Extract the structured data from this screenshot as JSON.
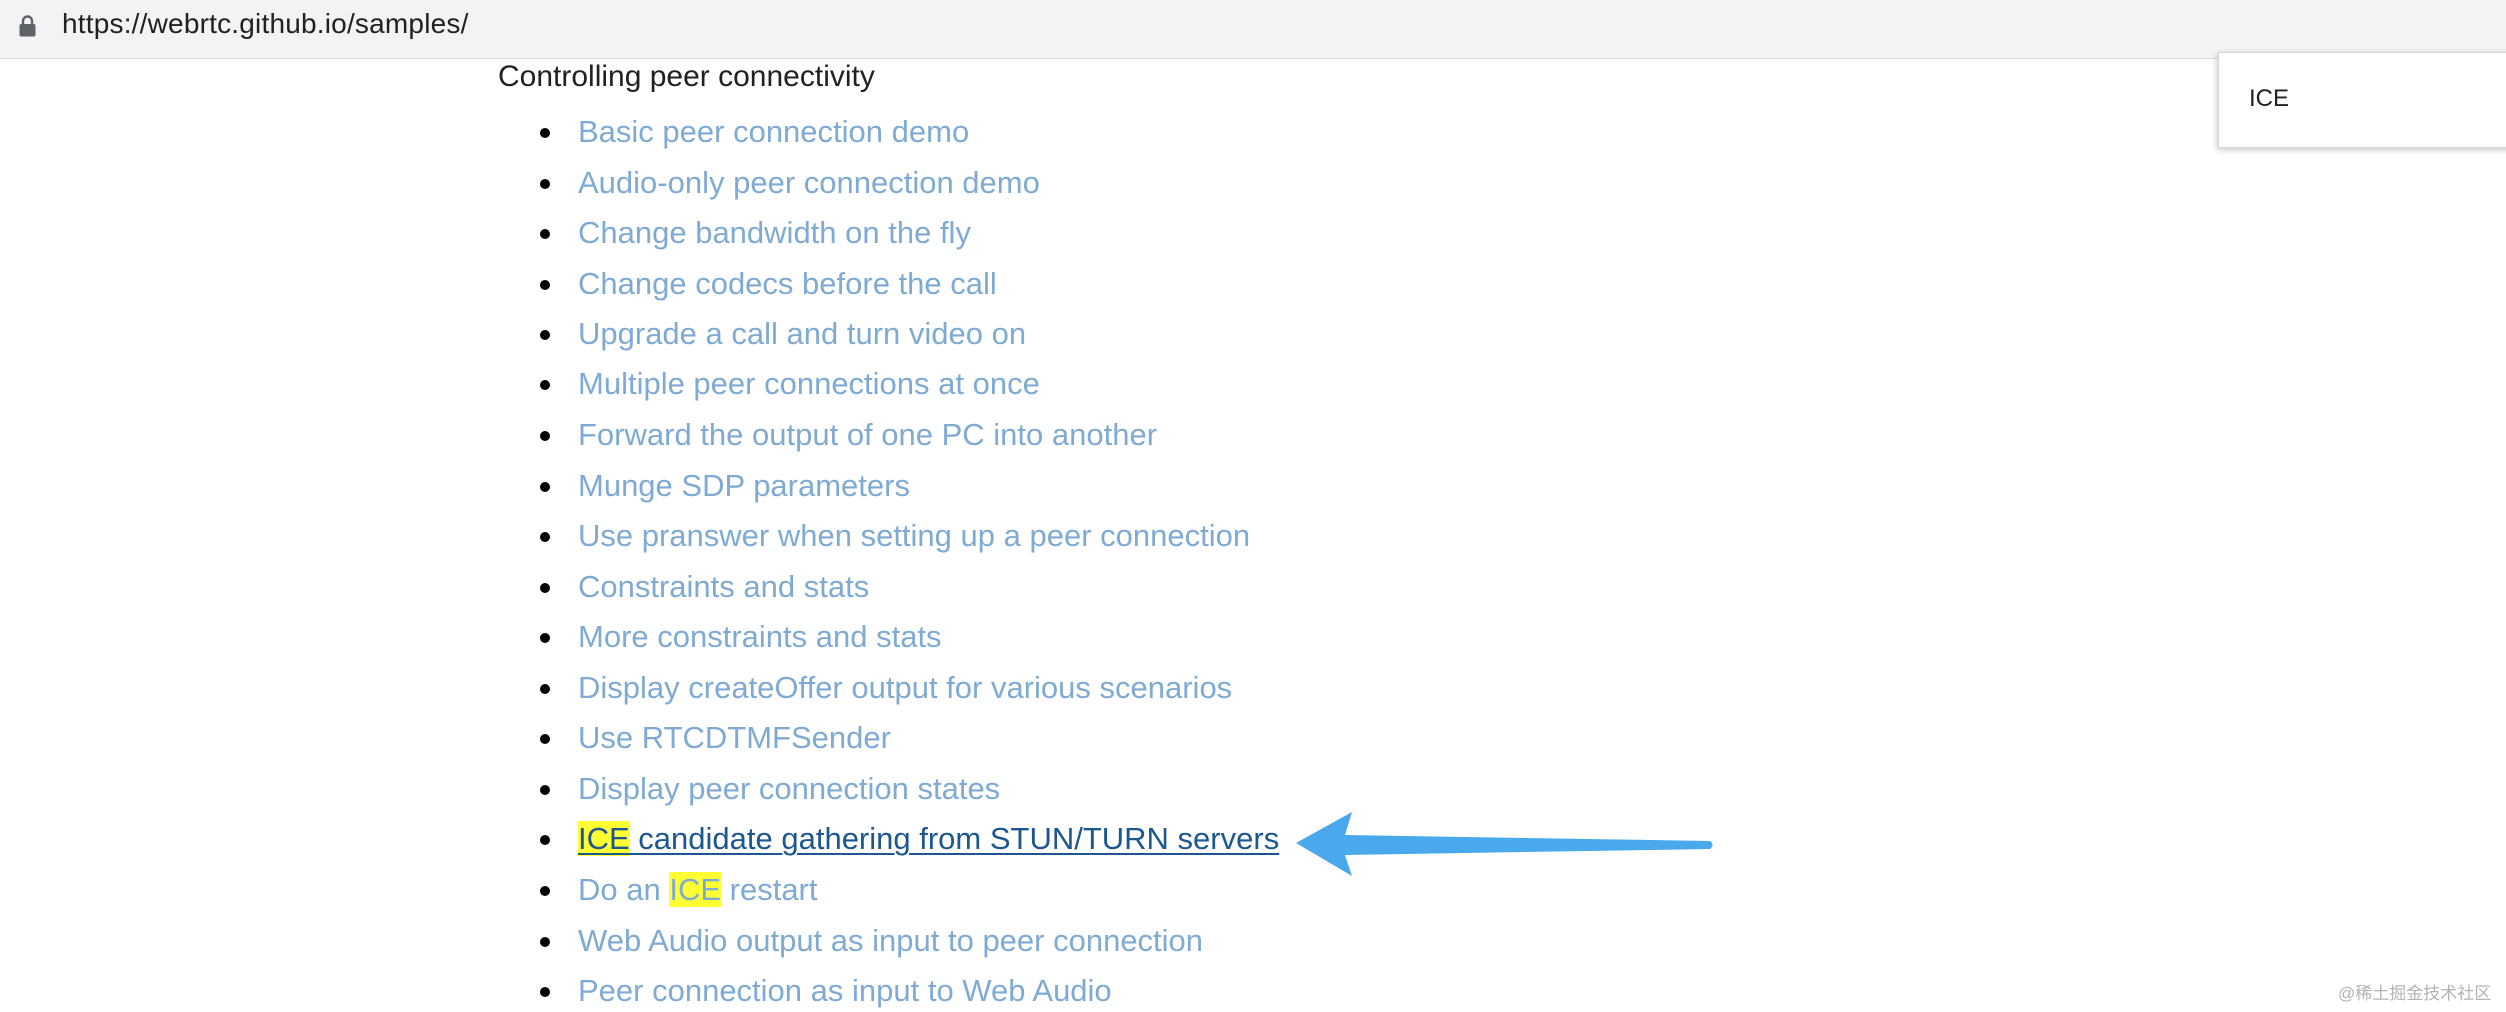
{
  "browser": {
    "url": "https://webrtc.github.io/samples/",
    "lock_icon": "lock-icon"
  },
  "section": {
    "title": "Controlling peer connectivity"
  },
  "samples": [
    {
      "label": "Basic peer connection demo"
    },
    {
      "label": "Audio-only peer connection demo"
    },
    {
      "label": "Change bandwidth on the fly"
    },
    {
      "label": "Change codecs before the call"
    },
    {
      "label": "Upgrade a call and turn video on"
    },
    {
      "label": "Multiple peer connections at once"
    },
    {
      "label": "Forward the output of one PC into another"
    },
    {
      "label": "Munge SDP parameters"
    },
    {
      "label": "Use pranswer when setting up a peer connection"
    },
    {
      "label": "Constraints and stats"
    },
    {
      "label": "More constraints and stats"
    },
    {
      "label": "Display createOffer output for various scenarios"
    },
    {
      "label": "Use RTCDTMFSender"
    },
    {
      "label": "Display peer connection states"
    },
    {
      "label_highlight": "ICE",
      "label_rest": " candidate gathering from STUN/TURN servers"
    },
    {
      "label_pre": "Do an ",
      "label_highlight": "ICE",
      "label_post": " restart"
    },
    {
      "label": "Web Audio output as input to peer connection"
    },
    {
      "label": "Peer connection as input to Web Audio"
    }
  ],
  "find_bar": {
    "query": "ICE"
  },
  "annotation": {
    "arrow_icon": "arrow-left-icon",
    "arrow_color": "#4aa8ec"
  },
  "colors": {
    "link": "#7faad4",
    "link_active": "#1c5791",
    "highlight": "#ffff33"
  },
  "watermark": {
    "text": "@稀土掘金技术社区"
  }
}
